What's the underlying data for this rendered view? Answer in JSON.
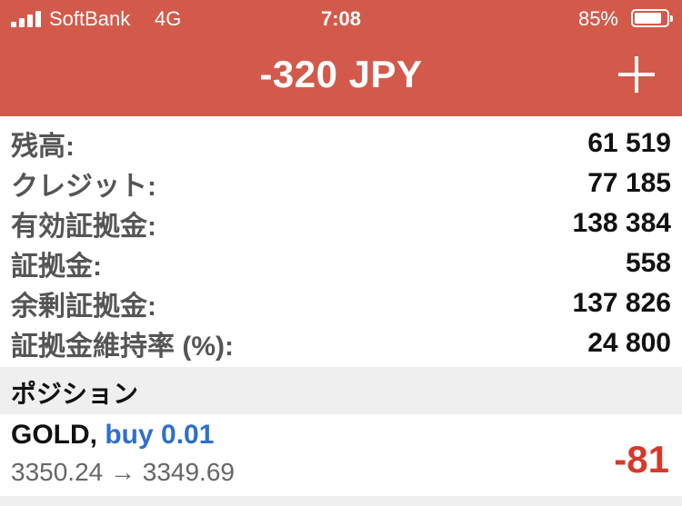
{
  "status_bar": {
    "carrier": "SoftBank",
    "network": "4G",
    "time": "7:08",
    "battery_percent_text": "85%",
    "battery_level": 0.85
  },
  "header": {
    "title": "-320 JPY",
    "add_icon": "plus-icon",
    "background_color": "#d35a4b"
  },
  "account": {
    "rows": [
      {
        "label": "残高:",
        "value": "61 519"
      },
      {
        "label": "クレジット:",
        "value": "77 185"
      },
      {
        "label": "有効証拠金:",
        "value": "138 384"
      },
      {
        "label": "証拠金:",
        "value": "558"
      },
      {
        "label": "余剰証拠金:",
        "value": "137 826"
      },
      {
        "label": "証拠金維持率 (%):",
        "value": "24 800"
      }
    ]
  },
  "positions": {
    "section_title": "ポジション",
    "items": [
      {
        "symbol": "GOLD,",
        "side_volume": "buy 0.01",
        "prices": "3350.24 → 3349.69",
        "profit": "-81"
      }
    ]
  },
  "colors": {
    "loss": "#d33a2c",
    "buy": "#2f6fcf"
  }
}
